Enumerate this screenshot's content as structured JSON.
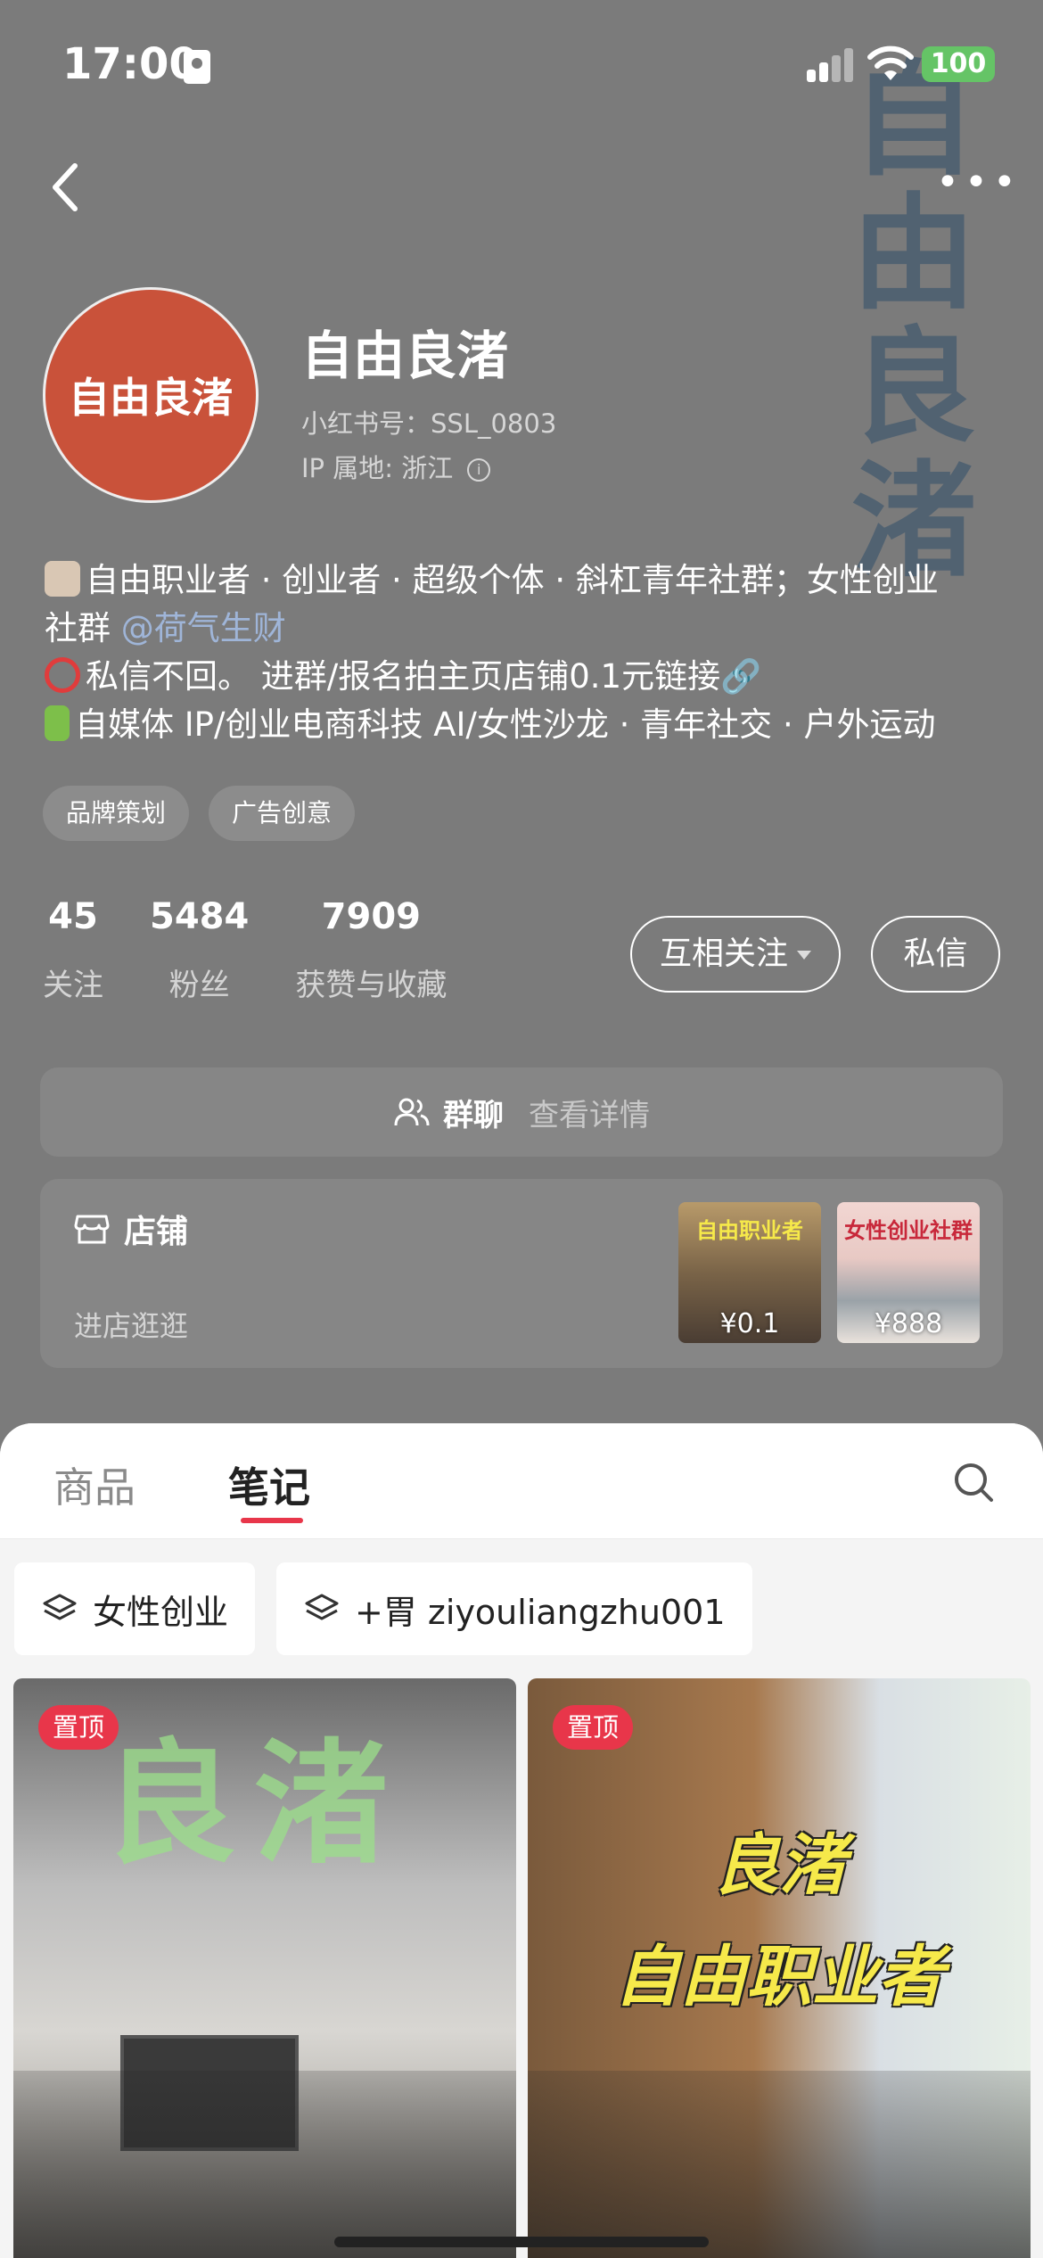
{
  "status_bar": {
    "time": "17:00",
    "battery": "100"
  },
  "background_text": "自由良渚",
  "profile": {
    "avatar_text": "自由良渚",
    "name": "自由良渚",
    "id_line": "小红书号：SSL_0803",
    "ip_line": "IP 属地: 浙江"
  },
  "bio": {
    "line1": "自由职业者 · 创业者 · 超级个体 · 斜杠青年社群；女性创业",
    "line2_prefix": "社群 ",
    "line2_mention": "@荷气生财",
    "line3": "私信不回。 进群/报名拍主页店铺0.1元链接🔗",
    "line4": "自媒体 IP/创业电商科技 AI/女性沙龙 · 青年社交 · 户外运动"
  },
  "tags": [
    "品牌策划",
    "广告创意"
  ],
  "stats": [
    {
      "value": "45",
      "label": "关注"
    },
    {
      "value": "5484",
      "label": "粉丝"
    },
    {
      "value": "7909",
      "label": "获赞与收藏"
    }
  ],
  "actions": {
    "mutual_follow": "互相关注",
    "message": "私信"
  },
  "group_chat": {
    "label": "群聊",
    "detail": "查看详情"
  },
  "store": {
    "title": "店铺",
    "subtitle": "进店逛逛",
    "items": [
      {
        "price": "¥0.1",
        "caption": "自由职业者"
      },
      {
        "price": "¥888",
        "caption": "女性创业社群"
      }
    ]
  },
  "tabs": {
    "goods": "商品",
    "notes": "笔记"
  },
  "filters": [
    "女性创业",
    "+胃 ziyouliangzhu001"
  ],
  "notes": [
    {
      "badge": "置顶",
      "overlay": "良渚"
    },
    {
      "badge": "置顶",
      "overlay_line1": "良渚",
      "overlay_line2": "自由职业者"
    }
  ],
  "colors": {
    "accent": "#e8364a",
    "header_bg": "#7b7b7b",
    "avatar_bg": "#c9523a"
  }
}
